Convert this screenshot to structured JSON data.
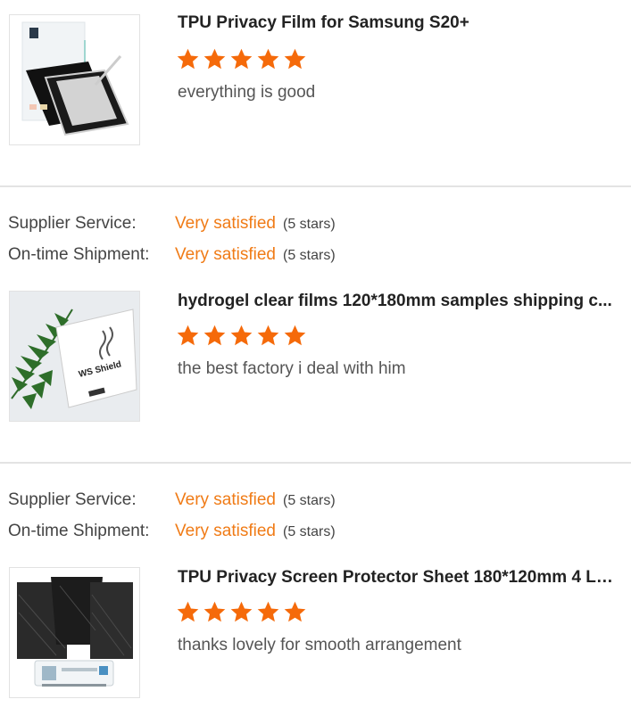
{
  "reviews": [
    {
      "product_title": "TPU Privacy Film for Samsung S20+",
      "rating": 5,
      "comment": "everything is good",
      "thumbnail": "privacy-film-tablet-image"
    },
    {
      "supplier_service_label": "Supplier Service:",
      "supplier_service_value": "Very satisfied",
      "supplier_service_stars": "(5 stars)",
      "shipment_label": "On-time Shipment:",
      "shipment_value": "Very satisfied",
      "shipment_stars": "(5 stars)",
      "product_title": "hydrogel clear films 120*180mm samples shipping c...",
      "rating": 5,
      "comment": "the best factory i deal with him",
      "thumbnail": "hydrogel-film-package-image",
      "thumbnail_text": "WS Shield"
    },
    {
      "supplier_service_label": "Supplier Service:",
      "supplier_service_value": "Very satisfied",
      "supplier_service_stars": "(5 stars)",
      "shipment_label": "On-time Shipment:",
      "shipment_value": "Very satisfied",
      "shipment_stars": "(5 stars)",
      "product_title": "TPU Privacy Screen Protector Sheet 180*120mm 4 La...",
      "rating": 5,
      "comment": "thanks lovely for smooth arrangement",
      "thumbnail": "privacy-sheets-and-cutter-image"
    }
  ],
  "colors": {
    "star": "#f56a0a",
    "satisfied": "#f07b16",
    "divider": "#e3e3e3"
  }
}
